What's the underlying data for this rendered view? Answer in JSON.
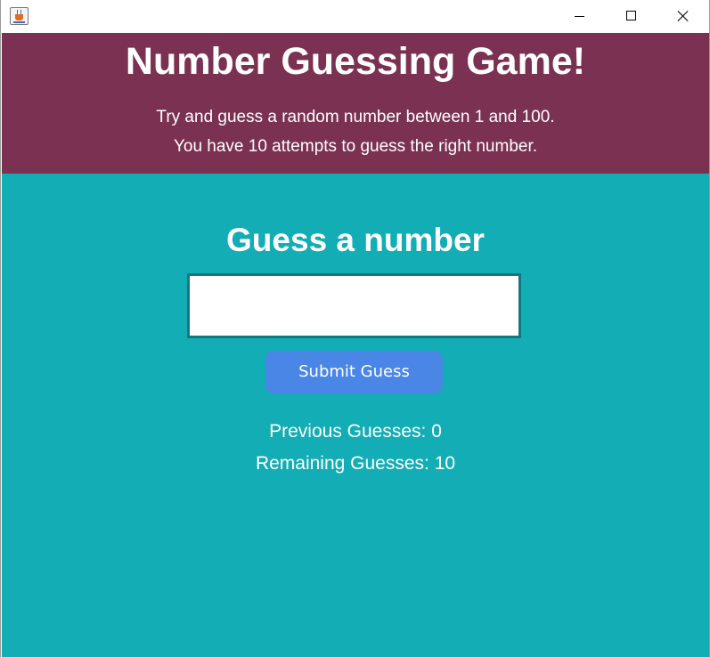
{
  "window": {
    "icon": "java-cup-icon",
    "controls": [
      "minimize-icon",
      "maximize-icon",
      "close-icon"
    ]
  },
  "header": {
    "title": "Number Guessing Game!",
    "subtitle_line1": "Try and guess a random number between 1 and 100.",
    "subtitle_line2": "You have 10 attempts to guess the right number.",
    "background": "#7b3152"
  },
  "main": {
    "background": "#12adb5",
    "prompt": "Guess a number",
    "input_value": "",
    "submit_label": "Submit Guess",
    "submit_color": "#4a86e6",
    "previous_guesses": "Previous Guesses: 0",
    "remaining_guesses": "Remaining Guesses: 10"
  }
}
